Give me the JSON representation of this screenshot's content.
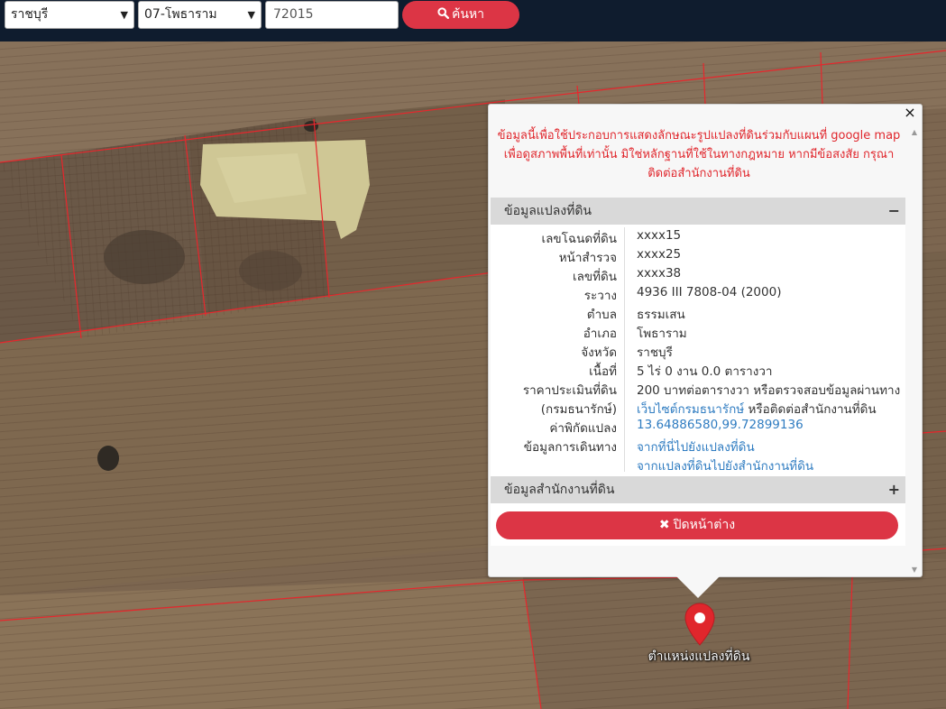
{
  "search": {
    "province": "ราชบุรี",
    "district": "07-โพธาราม",
    "parcel_input": "72015",
    "search_label": "ค้นหา"
  },
  "popup": {
    "notice_lines": [
      "ข้อมูลนี้เพื่อใช้ประกอบการแสดงลักษณะรูปแปลงที่ดินร่วมกับแผนที่ google map",
      "เพื่อดูสภาพพื้นที่เท่านั้น มิใช่หลักฐานที่ใช้ในทางกฎหมาย หากมีข้อสงสัย กรุณา",
      "ติดต่อสำนักงานที่ดิน"
    ],
    "land_section_title": "ข้อมูลแปลงที่ดิน",
    "land_section_toggle": "−",
    "office_section_title": "ข้อมูลสำนักงานที่ดิน",
    "office_section_toggle": "+",
    "rows": [
      {
        "label": "เลขโฉนดที่ดิน",
        "value": "xxxx15"
      },
      {
        "label": "หน้าสำรวจ",
        "value": "xxxx25"
      },
      {
        "label": "เลขที่ดิน",
        "value": "xxxx38"
      },
      {
        "label": "ระวาง",
        "value": "4936 III 7808-04 (2000)"
      },
      {
        "label": "ตำบล",
        "value": "ธรรมเสน"
      },
      {
        "label": "อำเภอ",
        "value": "โพธาราม"
      },
      {
        "label": "จังหวัด",
        "value": "ราชบุรี"
      },
      {
        "label": "เนื้อที่",
        "value": "5 ไร่ 0 งาน 0.0 ตารางวา"
      },
      {
        "label": "ราคาประเมินที่ดิน",
        "value": "200 บาทต่อตารางวา หรือตรวจสอบข้อมูลผ่านทาง"
      },
      {
        "label": "(กรมธนารักษ์)",
        "value_link": "เว็บไซต์กรมธนารักษ์",
        "value_rest": " หรือติดต่อสำนักงานที่ดิน"
      },
      {
        "label": "ค่าพิกัดแปลง",
        "value_link": "13.64886580,99.72899136"
      },
      {
        "label": "ข้อมูลการเดินทาง",
        "value_link": "จากที่นี่ไปยังแปลงที่ดิน"
      },
      {
        "label": "",
        "value_link": "จากแปลงที่ดินไปยังสำนักงานที่ดิน"
      }
    ],
    "close_button_label": "ปิดหน้าต่าง",
    "close_x": "×"
  },
  "marker": {
    "label": "ตำแหน่งแปลงที่ดิน",
    "color": "#e0262c"
  },
  "colors": {
    "topbar": "#0f1c2e",
    "accent": "#dc3545",
    "link": "#2f7cc1",
    "notice": "#e0262c",
    "parcel_line": "#e8262c"
  },
  "icons": {
    "search": "search-icon",
    "close": "times-icon",
    "marker": "map-pin-icon"
  }
}
